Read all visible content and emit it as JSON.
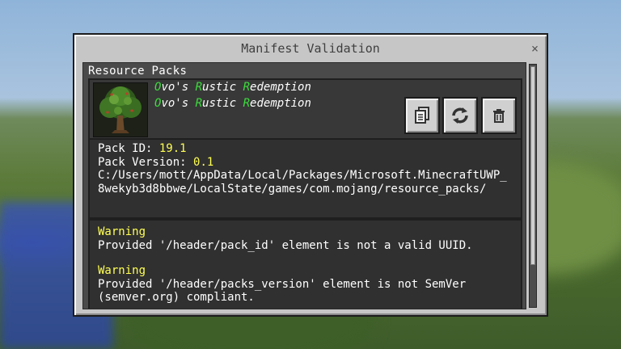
{
  "dialog": {
    "title": "Manifest Validation",
    "close_glyph": "×"
  },
  "section": {
    "label": "Resource Packs"
  },
  "pack": {
    "name_line1": {
      "c1": "O",
      "t1": "vo's ",
      "c2": "R",
      "t2": "ustic ",
      "c3": "R",
      "t3": "edemption"
    },
    "name_line2": {
      "c1": "O",
      "t1": "vo's ",
      "c2": "R",
      "t2": "ustic ",
      "c3": "R",
      "t3": "edemption"
    },
    "icon": "oak-tree-pack-icon",
    "buttons": [
      {
        "icon": "copy-icon"
      },
      {
        "icon": "reload-icon"
      },
      {
        "icon": "trash-icon"
      }
    ]
  },
  "details": {
    "pack_id_label": "Pack ID: ",
    "pack_id_value": "19.1",
    "pack_version_label": "Pack Version: ",
    "pack_version_value": "0.1",
    "path": "C:/Users/mott/AppData/Local/Packages/Microsoft.MinecraftUWP_8wekyb3d8bbwe/LocalState/games/com.mojang/resource_packs/"
  },
  "warnings": [
    {
      "title": "Warning",
      "message": "Provided '/header/pack_id' element is not a valid UUID."
    },
    {
      "title": "Warning",
      "message": "Provided '/header/packs_version' element is not SemVer (semver.org) compliant."
    }
  ],
  "colors": {
    "accent_green": "#3cdc3c",
    "warning_yellow": "#ffff55",
    "dialog_bg": "#c6c6c6",
    "panel_bg": "#303030"
  }
}
